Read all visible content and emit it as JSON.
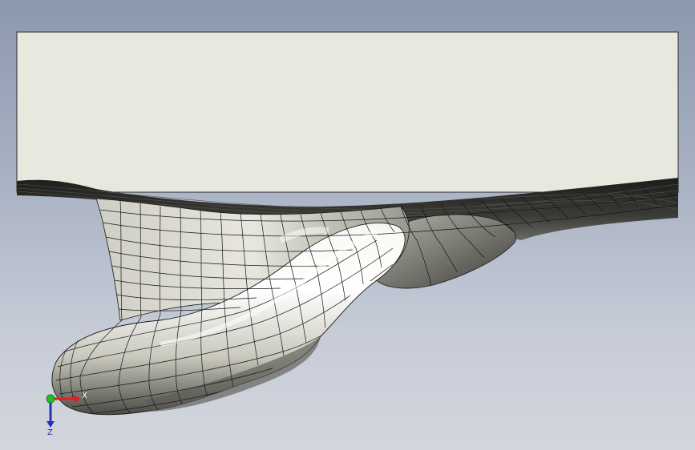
{
  "viewport": {
    "background_top": "#8c98ae",
    "background_bottom": "#d3d6de"
  },
  "model": {
    "description_icon": "cad-surface-mesh",
    "block_face_color": "#e9e8de",
    "surface_color": "#e6e5da",
    "mesh_line_color": "#1a1a1a"
  },
  "triad": {
    "x_label": "X",
    "y_label": "",
    "z_label": "Z",
    "x_color": "#e02020",
    "y_color": "#20c020",
    "z_color": "#2030c0"
  }
}
